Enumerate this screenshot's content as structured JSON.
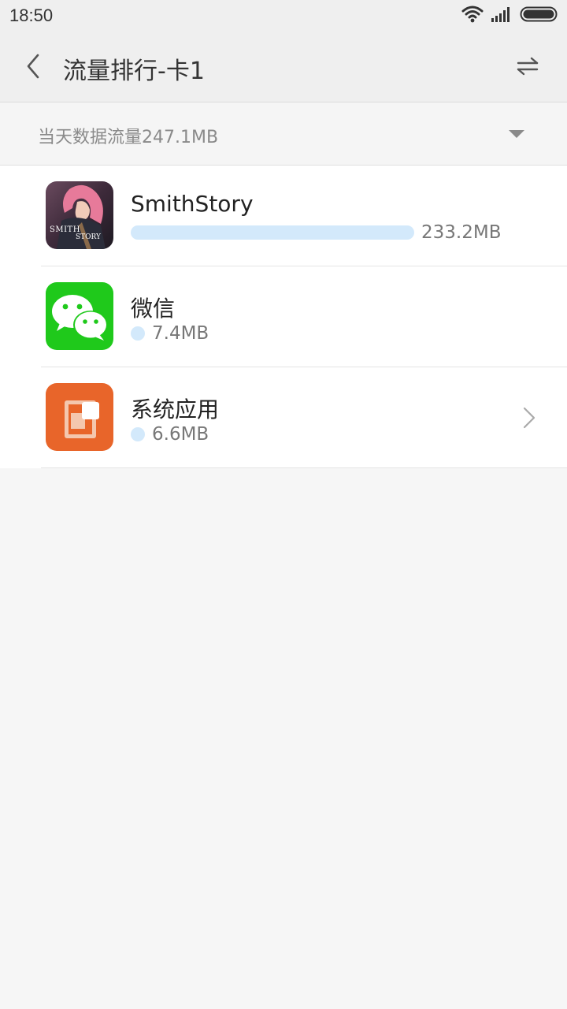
{
  "status_bar": {
    "time": "18:50",
    "icons": [
      "wifi-icon",
      "signal-icon",
      "battery-icon"
    ]
  },
  "header": {
    "title": "流量排行-卡1",
    "back_icon": "chevron-left-icon",
    "switch_icon": "swap-arrows-icon"
  },
  "summary": {
    "text": "当天数据流量247.1MB",
    "dropdown_icon": "triangle-down-icon"
  },
  "apps": [
    {
      "name": "SmithStory",
      "usage": "233.2MB",
      "usage_mb": 233.2,
      "icon": "smithstory-app-icon",
      "icon_text_1": "SMITH",
      "icon_text_2": "STORY"
    },
    {
      "name": "微信",
      "usage": "7.4MB",
      "usage_mb": 7.4,
      "icon": "wechat-app-icon"
    },
    {
      "name": "系统应用",
      "usage": "6.6MB",
      "usage_mb": 6.6,
      "icon": "system-app-icon",
      "has_chevron": true
    }
  ],
  "colors": {
    "usage_bar": "#d3e9fb",
    "wechat_green": "#1fc91b",
    "system_orange": "#e8652a"
  }
}
